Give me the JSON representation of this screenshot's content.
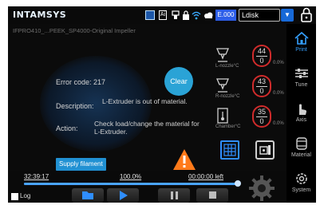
{
  "topbar": {
    "brand": "INTAMSYS",
    "doc_icon_text": "Ai",
    "energy_label": "E.000",
    "profile": "Ldisk"
  },
  "file": {
    "name": "IFPRO410_...PEEK_SP4000-Original Impeller"
  },
  "error": {
    "code_label": "Error code: 217",
    "description_label": "Description:",
    "description_text": "L-Extruder is out of material.",
    "action_label": "Action:",
    "action_text": "Check load/change the material for L-Extruder.",
    "clear_label": "Clear",
    "supply_label": "Supply filament"
  },
  "temps": [
    {
      "label": "L-nozzle°C",
      "target": "44",
      "current": "0",
      "pct": "0.0%"
    },
    {
      "label": "R-nozzle°C",
      "target": "43",
      "current": "0",
      "pct": "0.0%"
    },
    {
      "label": "Chamber°C",
      "target": "35",
      "current": "0",
      "pct": "0.0%"
    }
  ],
  "progress": {
    "elapsed": "32:39:17",
    "percent_label": "100.0%",
    "percent_value": 100,
    "remaining": "00:00:00 left",
    "log_label": "Log"
  },
  "sidebar": {
    "items": [
      {
        "label": "Print",
        "icon": "home-icon",
        "active": true
      },
      {
        "label": "Tune",
        "icon": "sliders-icon"
      },
      {
        "label": "Axis",
        "icon": "hand-icon"
      },
      {
        "label": "Material",
        "icon": "spool-icon"
      },
      {
        "label": "System",
        "icon": "gear-icon"
      }
    ]
  },
  "colors": {
    "accent": "#2f8eff",
    "active": "#35a0ff",
    "clear_button": "#2aa3d6",
    "warning": "#ff7a1a",
    "gauge": "#cf2b2b"
  }
}
